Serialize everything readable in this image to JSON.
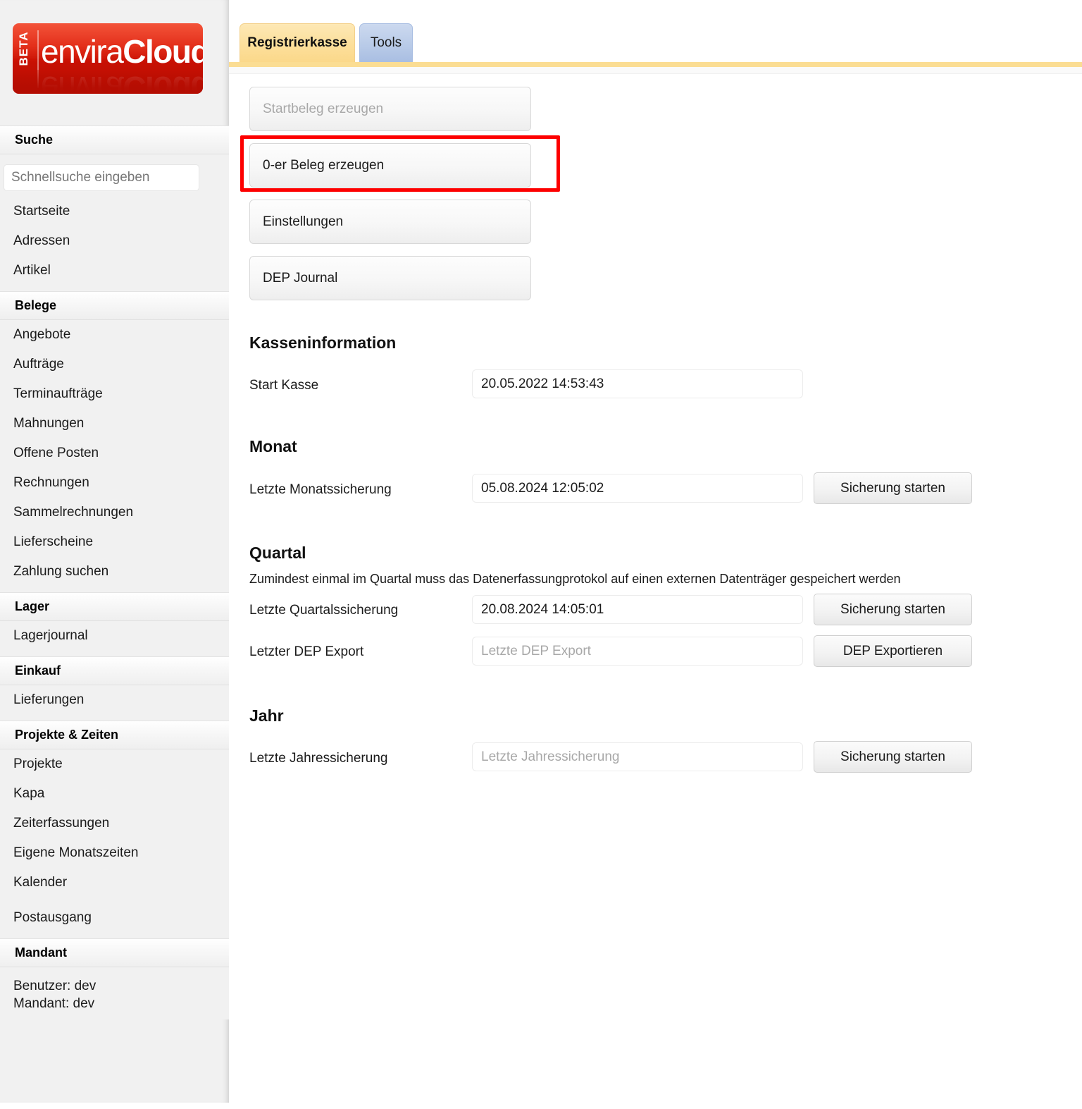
{
  "brand": {
    "name_light": "envira",
    "name_bold": "Cloud",
    "badge": "BETA",
    "accent_color": "#d41203"
  },
  "sidebar": {
    "search": {
      "header": "Suche",
      "placeholder": "Schnellsuche eingeben",
      "value": ""
    },
    "top_items": [
      {
        "label": "Startseite"
      },
      {
        "label": "Adressen"
      },
      {
        "label": "Artikel"
      }
    ],
    "sections": [
      {
        "header": "Belege",
        "items": [
          {
            "label": "Angebote"
          },
          {
            "label": "Aufträge"
          },
          {
            "label": "Terminaufträge"
          },
          {
            "label": "Mahnungen"
          },
          {
            "label": "Offene Posten"
          },
          {
            "label": "Rechnungen"
          },
          {
            "label": "Sammelrechnungen"
          },
          {
            "label": "Lieferscheine"
          },
          {
            "label": "Zahlung suchen"
          }
        ]
      },
      {
        "header": "Lager",
        "items": [
          {
            "label": "Lagerjournal"
          }
        ]
      },
      {
        "header": "Einkauf",
        "items": [
          {
            "label": "Lieferungen"
          }
        ]
      },
      {
        "header": "Projekte & Zeiten",
        "items": [
          {
            "label": "Projekte"
          },
          {
            "label": "Kapa"
          },
          {
            "label": "Zeiterfassungen"
          },
          {
            "label": "Eigene Monatszeiten"
          },
          {
            "label": "Kalender"
          },
          {
            "label": "Postausgang"
          }
        ]
      }
    ],
    "mandant": {
      "header": "Mandant",
      "user_line": "Benutzer: dev",
      "mandant_line": "Mandant: dev"
    }
  },
  "tabs": [
    {
      "label": "Registrierkasse",
      "active": true
    },
    {
      "label": "Tools",
      "active": false
    }
  ],
  "actions": [
    {
      "label": "Startbeleg erzeugen",
      "disabled": true,
      "highlighted": false
    },
    {
      "label": "0-er Beleg erzeugen",
      "disabled": false,
      "highlighted": true
    },
    {
      "label": "Einstellungen",
      "disabled": false,
      "highlighted": false
    },
    {
      "label": "DEP Journal",
      "disabled": false,
      "highlighted": false
    }
  ],
  "highlight": {
    "color": "#fd0000",
    "target": "0-er Beleg erzeugen"
  },
  "sections": {
    "kasseninformation": {
      "title": "Kasseninformation",
      "rows": [
        {
          "label": "Start Kasse",
          "value": "20.05.2022 14:53:43",
          "placeholder": "",
          "button": null
        }
      ]
    },
    "monat": {
      "title": "Monat",
      "note": "",
      "rows": [
        {
          "label": "Letzte Monatssicherung",
          "value": "05.08.2024 12:05:02",
          "placeholder": "",
          "button": "Sicherung starten"
        }
      ]
    },
    "quartal": {
      "title": "Quartal",
      "note": "Zumindest einmal im Quartal muss das Datenerfassungprotokol auf einen externen Datenträger gespeichert werden",
      "rows": [
        {
          "label": "Letzte Quartalssicherung",
          "value": "20.08.2024 14:05:01",
          "placeholder": "",
          "button": "Sicherung starten"
        },
        {
          "label": "Letzter DEP Export",
          "value": "",
          "placeholder": "Letzte DEP Export",
          "button": "DEP Exportieren"
        }
      ]
    },
    "jahr": {
      "title": "Jahr",
      "note": "",
      "rows": [
        {
          "label": "Letzte Jahressicherung",
          "value": "",
          "placeholder": "Letzte Jahressicherung",
          "button": "Sicherung starten"
        }
      ]
    }
  }
}
